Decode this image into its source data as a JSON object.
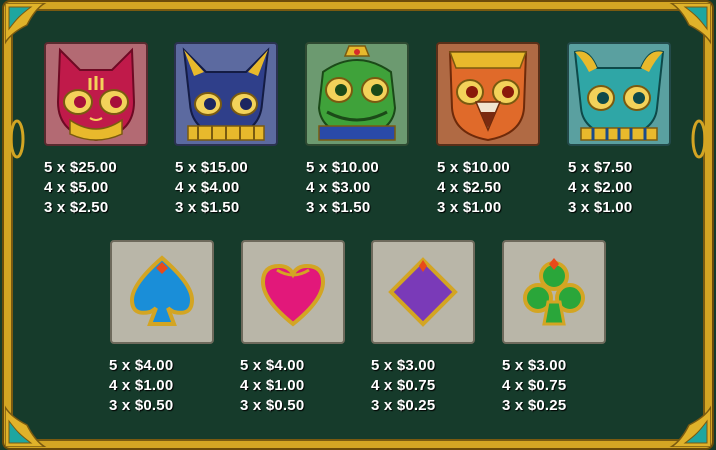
{
  "colors": {
    "frame": "#d3a523",
    "panel": "#163b2b",
    "text": "#ffffff"
  },
  "symbols_top": [
    {
      "name": "red cat mask",
      "icon": "cat-mask-icon",
      "pays": [
        "5 x $25.00",
        "4 x $5.00",
        "3 x $2.50"
      ]
    },
    {
      "name": "blue jackal mask",
      "icon": "jackal-mask-icon",
      "pays": [
        "5 x $15.00",
        "4 x $4.00",
        "3 x $1.50"
      ]
    },
    {
      "name": "green croc mask",
      "icon": "croc-mask-icon",
      "pays": [
        "5 x $10.00",
        "4 x $3.00",
        "3 x $1.50"
      ]
    },
    {
      "name": "orange falcon mask",
      "icon": "falcon-mask-icon",
      "pays": [
        "5 x $10.00",
        "4 x $2.50",
        "3 x $1.00"
      ]
    },
    {
      "name": "teal ram mask",
      "icon": "ram-mask-icon",
      "pays": [
        "5 x $7.50",
        "4 x $2.00",
        "3 x $1.00"
      ]
    }
  ],
  "symbols_bottom": [
    {
      "name": "spade",
      "icon": "spade-icon",
      "pays": [
        "5 x $4.00",
        "4 x $1.00",
        "3 x $0.50"
      ]
    },
    {
      "name": "heart",
      "icon": "heart-icon",
      "pays": [
        "5 x $4.00",
        "4 x $1.00",
        "3 x $0.50"
      ]
    },
    {
      "name": "diamond",
      "icon": "diamond-icon",
      "pays": [
        "5 x $3.00",
        "4 x $0.75",
        "3 x $0.25"
      ]
    },
    {
      "name": "club",
      "icon": "club-icon",
      "pays": [
        "5 x $3.00",
        "4 x $0.75",
        "3 x $0.25"
      ]
    }
  ]
}
